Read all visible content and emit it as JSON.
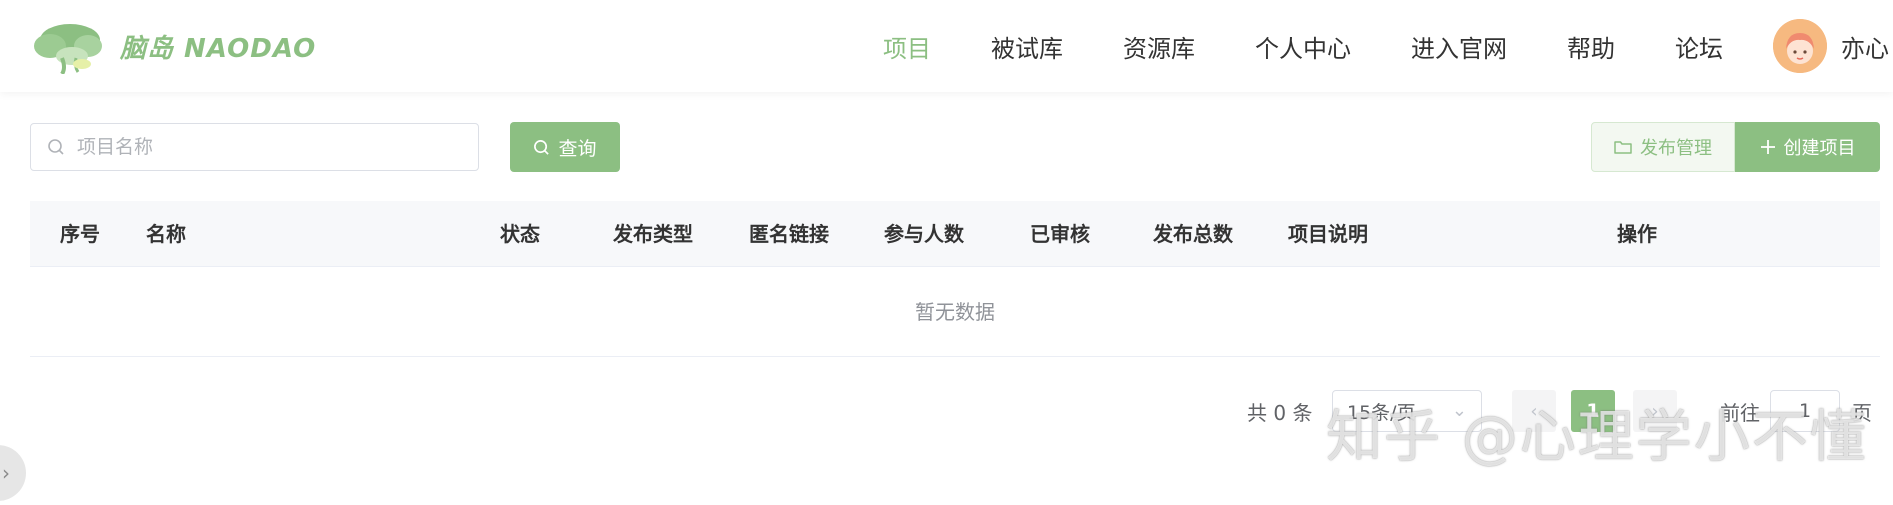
{
  "header": {
    "logo_text": "脑岛 NAODAO",
    "nav": [
      {
        "label": "项目",
        "active": true
      },
      {
        "label": "被试库",
        "active": false
      },
      {
        "label": "资源库",
        "active": false
      },
      {
        "label": "个人中心",
        "active": false
      },
      {
        "label": "进入官网",
        "active": false
      },
      {
        "label": "帮助",
        "active": false
      },
      {
        "label": "论坛",
        "active": false
      }
    ],
    "user_name": "亦心"
  },
  "toolbar": {
    "search_placeholder": "项目名称",
    "query_label": "查询",
    "publish_label": "发布管理",
    "create_label": "创建项目"
  },
  "table": {
    "columns": [
      "序号",
      "名称",
      "状态",
      "发布类型",
      "匿名链接",
      "参与人数",
      "已审核",
      "发布总数",
      "项目说明",
      "操作"
    ],
    "empty_text": "暂无数据"
  },
  "pagination": {
    "total_text": "共 0 条",
    "page_size": "15条/页",
    "current_page": "1",
    "goto_label": "前往",
    "goto_value": "1",
    "page_suffix": "页"
  },
  "watermark": "知乎 @心理学小不懂",
  "colors": {
    "accent": "#8cbf82",
    "header_bg": "#ffffff",
    "table_head_bg": "#f7f8fa"
  }
}
